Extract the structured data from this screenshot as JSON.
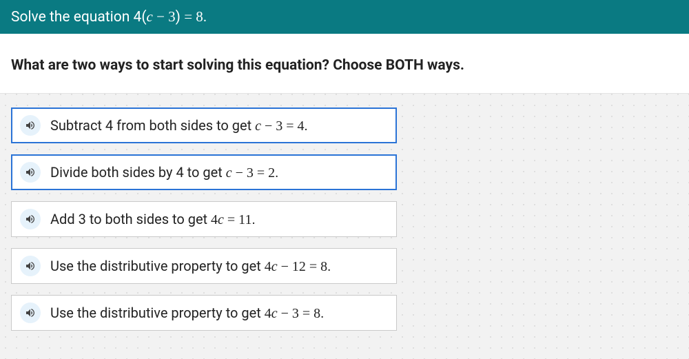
{
  "header": {
    "prefix": "Solve the equation ",
    "equation_html": "4(<span class='math-var'>c</span> <span class='eqpart'>&minus;</span> <span class='math-num'>3</span>) <span class='eqpart'>=</span> <span class='math-num'>8</span>.",
    "equation_plain": "4(c − 3) = 8."
  },
  "prompt": "What are two ways to start solving this equation? Choose BOTH ways.",
  "options": [
    {
      "selected": true,
      "text_html": "Subtract 4 from both sides to get <span class='math-var'>c</span> <span class='minus'>&minus;</span> <span class='eq'>3 = 4</span>.",
      "text_plain": "Subtract 4 from both sides to get c − 3 = 4."
    },
    {
      "selected": true,
      "text_html": "Divide both sides by 4 to get <span class='math-var'>c</span> <span class='minus'>&minus;</span> <span class='eq'>3 = 2</span>.",
      "text_plain": "Divide both sides by 4 to get c − 3 = 2."
    },
    {
      "selected": false,
      "text_html": "Add 3 to both sides to get <span class='eq'>4</span><span class='math-var'>c</span> <span class='eq'>= 11</span>.",
      "text_plain": "Add 3 to both sides to get 4c = 11."
    },
    {
      "selected": false,
      "text_html": "Use the distributive property to get <span class='eq'>4</span><span class='math-var'>c</span> <span class='minus'>&minus;</span> <span class='eq'>12 = 8</span>.",
      "text_plain": "Use the distributive property to get 4c − 12 = 8."
    },
    {
      "selected": false,
      "text_html": "Use the distributive property to get <span class='eq'>4</span><span class='math-var'>c</span> <span class='minus'>&minus;</span> <span class='eq'>3 = 8</span>.",
      "text_plain": "Use the distributive property to get 4c − 3 = 8."
    }
  ],
  "icons": {
    "speaker": "speaker-icon"
  }
}
